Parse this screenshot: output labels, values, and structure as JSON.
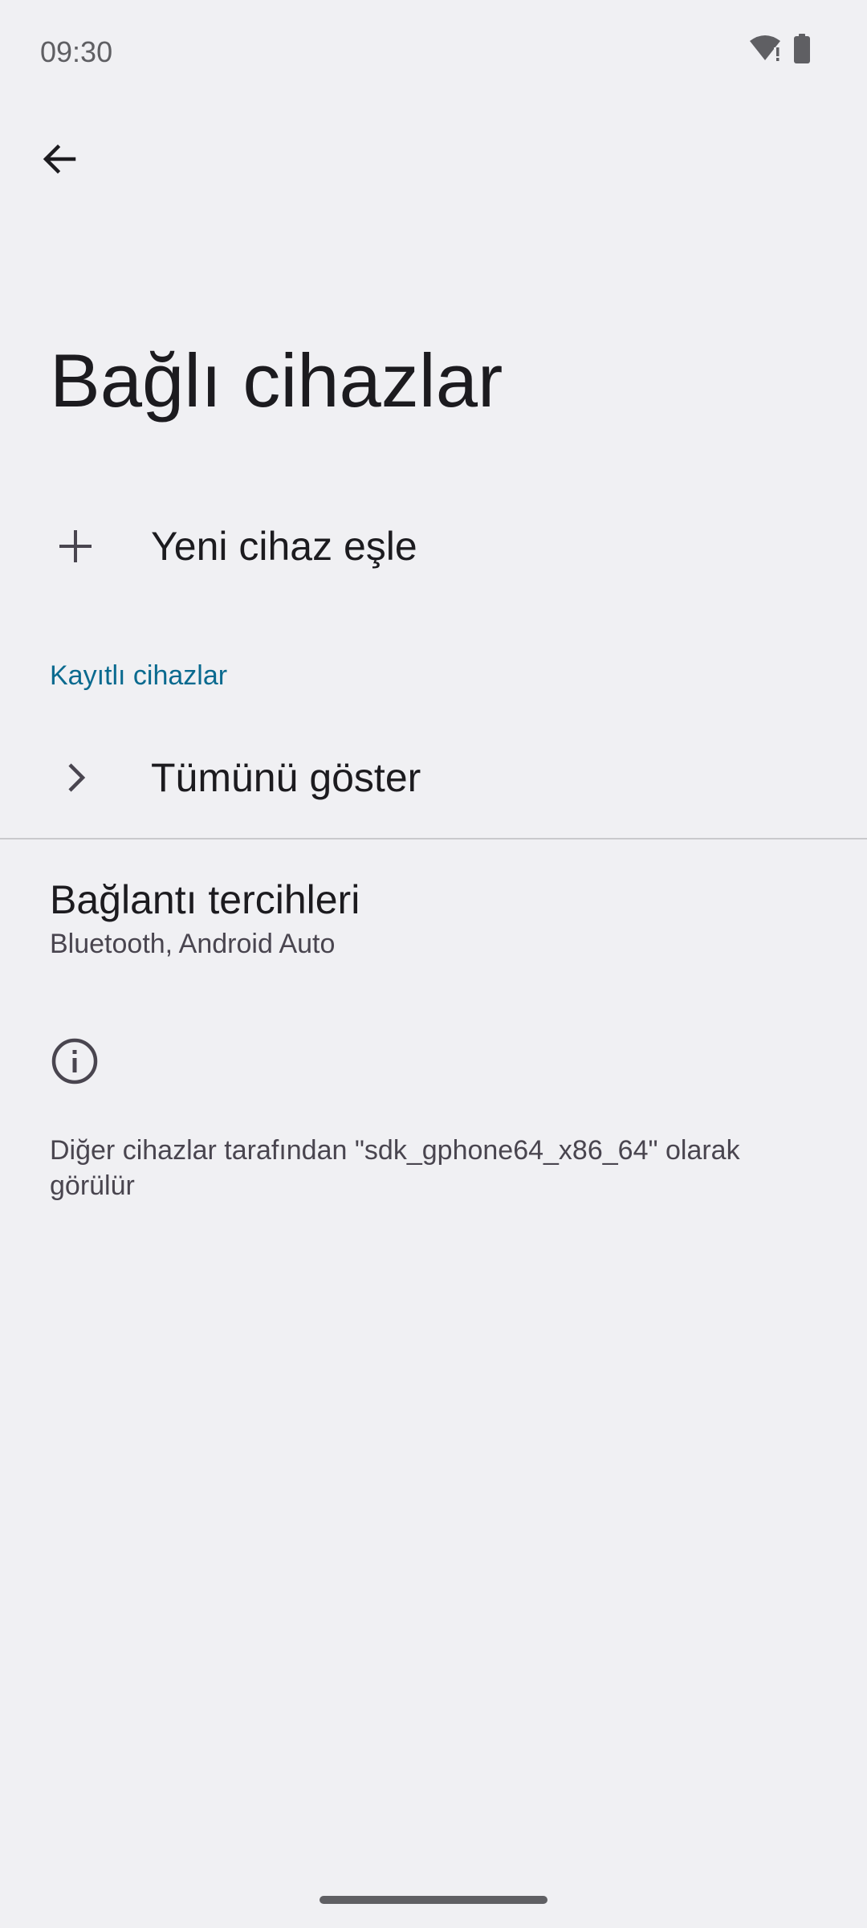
{
  "status_bar": {
    "time": "09:30",
    "icons": [
      "wifi-alert-icon",
      "battery-icon"
    ]
  },
  "toolbar": {
    "back_icon": "arrow-back-icon"
  },
  "page": {
    "title": "Bağlı cihazlar"
  },
  "pair_new_device": {
    "icon": "plus-icon",
    "label": "Yeni cihaz eşle"
  },
  "saved_devices": {
    "header": "Kayıtlı cihazlar",
    "show_all": {
      "icon": "chevron-right-icon",
      "label": "Tümünü göster"
    }
  },
  "connection_preferences": {
    "title": "Bağlantı tercihleri",
    "summary": "Bluetooth, Android Auto"
  },
  "footer": {
    "icon": "info-icon",
    "text": "Diğer cihazlar tarafından \"sdk_gphone64_x86_64\" olarak görülür"
  },
  "colors": {
    "background": "#f0f0f3",
    "accent": "#0a6a8f",
    "text_primary": "#1c1b1f",
    "text_secondary": "#49454f"
  }
}
